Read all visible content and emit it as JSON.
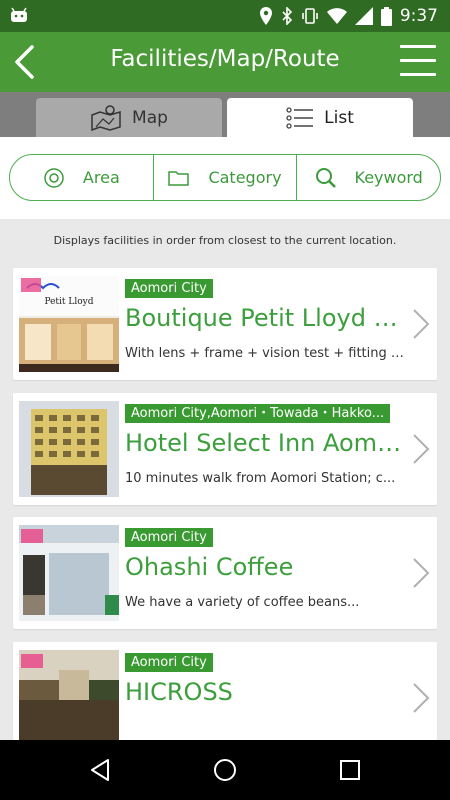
{
  "status_bar": {
    "time": "9:37"
  },
  "app_bar": {
    "title": "Facilities/Map/Route"
  },
  "tabs": [
    {
      "label": "Map",
      "icon": "map-icon"
    },
    {
      "label": "List",
      "icon": "list-icon"
    }
  ],
  "filters": [
    {
      "label": "Area",
      "icon": "target-icon"
    },
    {
      "label": "Category",
      "icon": "folder-icon"
    },
    {
      "label": "Keyword",
      "icon": "search-icon"
    }
  ],
  "notice": "Displays facilities in order from closest to the current location.",
  "facilities": [
    {
      "tag": "Aomori City",
      "name": "Boutique Petit Lloyd G...",
      "desc": "With lens + frame + vision test + fitting +...",
      "thumb_sign": "Petit Lloyd"
    },
    {
      "tag": "Aomori City,Aomori・Towada・Hakko...",
      "name": "Hotel Select Inn Aomo...",
      "desc": "10 minutes walk from Aomori Station; c..."
    },
    {
      "tag": "Aomori City",
      "name": "Ohashi Coffee",
      "desc": "We have a variety of coffee beans..."
    },
    {
      "tag": "Aomori City",
      "name": "HICROSS",
      "desc": ""
    }
  ],
  "colors": {
    "accent": "#4a9b38",
    "status_bar": "#2f6b22",
    "tag": "#3a9a32",
    "text_green": "#3c9f3c"
  }
}
